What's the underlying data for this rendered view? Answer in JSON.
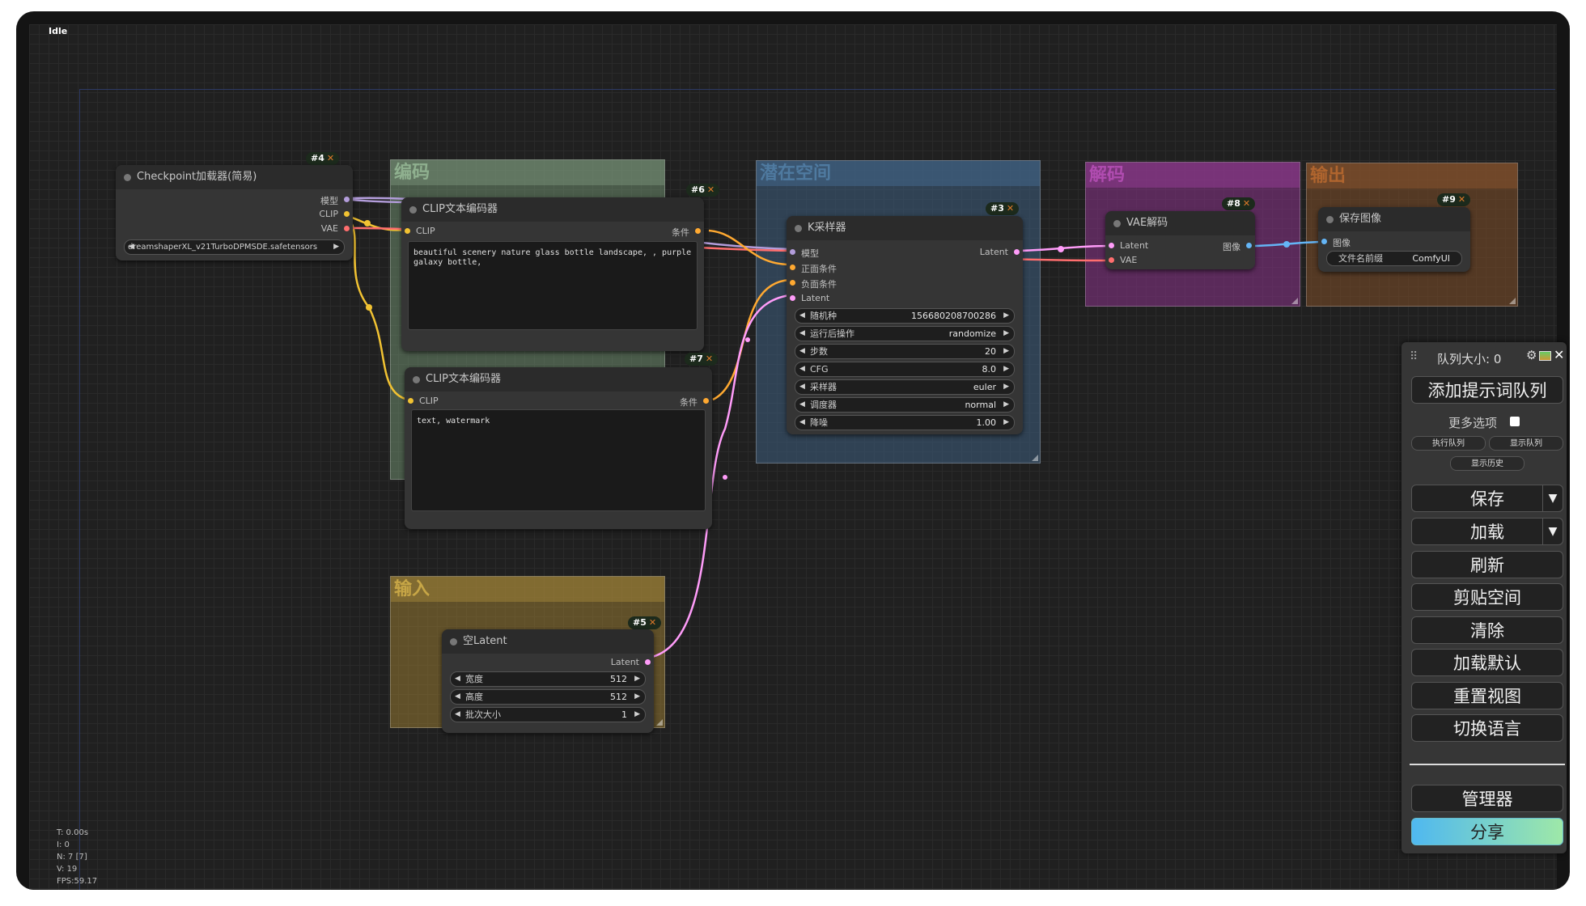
{
  "status": "Idle",
  "stats": {
    "t": "T: 0.00s",
    "i": "I: 0",
    "n": "N: 7 [7]",
    "v": "V: 19",
    "fps": "FPS:59.17"
  },
  "colors": {
    "clip_link": "#f1c232",
    "model_link": "#b39ddb",
    "vae_link": "#ff6e6e",
    "latent_link": "#ff9cf9",
    "image_link": "#64b5f6",
    "cond_link": "#ffa931"
  },
  "groups": {
    "encode": {
      "title": "编码"
    },
    "input": {
      "title": "输入"
    },
    "latent": {
      "title": "潜在空间"
    },
    "decode": {
      "title": "解码"
    },
    "output": {
      "title": "输出"
    }
  },
  "nodes": {
    "checkpoint": {
      "badge": "#4",
      "title": "Checkpoint加载器(简易)",
      "out_model": "模型",
      "out_clip": "CLIP",
      "out_vae": "VAE",
      "ckpt_name": "dreamshaperXL_v21TurboDPMSDE.safetensors"
    },
    "clip_pos": {
      "badge": "#6",
      "title": "CLIP文本编码器",
      "in_clip": "CLIP",
      "out_cond": "条件",
      "text": "beautiful scenery nature glass bottle landscape, , purple galaxy bottle,"
    },
    "clip_neg": {
      "badge": "#7",
      "title": "CLIP文本编码器",
      "in_clip": "CLIP",
      "out_cond": "条件",
      "text": "text, watermark"
    },
    "empty_latent": {
      "badge": "#5",
      "title": "空Latent",
      "out_latent": "Latent",
      "widgets": [
        {
          "label": "宽度",
          "value": "512"
        },
        {
          "label": "高度",
          "value": "512"
        },
        {
          "label": "批次大小",
          "value": "1"
        }
      ]
    },
    "ksampler": {
      "badge": "#3",
      "title": "K采样器",
      "in_model": "模型",
      "in_pos": "正面条件",
      "in_neg": "负面条件",
      "in_latent": "Latent",
      "out_latent": "Latent",
      "widgets": [
        {
          "label": "随机种",
          "value": "156680208700286"
        },
        {
          "label": "运行后操作",
          "value": "randomize"
        },
        {
          "label": "步数",
          "value": "20"
        },
        {
          "label": "CFG",
          "value": "8.0"
        },
        {
          "label": "采样器",
          "value": "euler"
        },
        {
          "label": "调度器",
          "value": "normal"
        },
        {
          "label": "降噪",
          "value": "1.00"
        }
      ]
    },
    "vae_decode": {
      "badge": "#8",
      "title": "VAE解码",
      "in_latent": "Latent",
      "in_vae": "VAE",
      "out_image": "图像"
    },
    "save_image": {
      "badge": "#9",
      "title": "保存图像",
      "in_image": "图像",
      "prefix_label": "文件名前缀",
      "prefix_value": "ComfyUI"
    }
  },
  "menu": {
    "queue_size": "队列大小: 0",
    "queue_prompt": "添加提示词队列",
    "extra_options": "更多选项",
    "view_queue": "执行队列",
    "show_queue": "显示队列",
    "view_history": "显示历史",
    "save": "保存",
    "load": "加载",
    "refresh": "刷新",
    "clipspace": "剪贴空间",
    "clear": "清除",
    "load_default": "加载默认",
    "reset_view": "重置视图",
    "switch_locale": "切换语言",
    "manager": "管理器",
    "share": "分享"
  }
}
